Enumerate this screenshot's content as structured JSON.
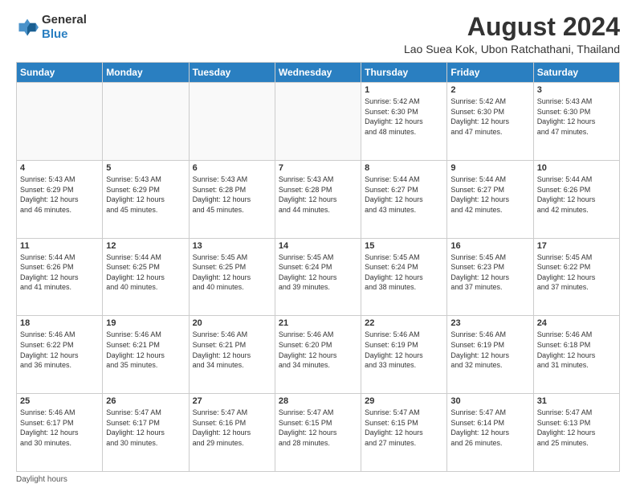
{
  "logo": {
    "general": "General",
    "blue": "Blue"
  },
  "header": {
    "month_year": "August 2024",
    "location": "Lao Suea Kok, Ubon Ratchathani, Thailand"
  },
  "days_of_week": [
    "Sunday",
    "Monday",
    "Tuesday",
    "Wednesday",
    "Thursday",
    "Friday",
    "Saturday"
  ],
  "footer": {
    "note": "Daylight hours"
  },
  "weeks": [
    [
      {
        "day": "",
        "info": ""
      },
      {
        "day": "",
        "info": ""
      },
      {
        "day": "",
        "info": ""
      },
      {
        "day": "",
        "info": ""
      },
      {
        "day": "1",
        "info": "Sunrise: 5:42 AM\nSunset: 6:30 PM\nDaylight: 12 hours\nand 48 minutes."
      },
      {
        "day": "2",
        "info": "Sunrise: 5:42 AM\nSunset: 6:30 PM\nDaylight: 12 hours\nand 47 minutes."
      },
      {
        "day": "3",
        "info": "Sunrise: 5:43 AM\nSunset: 6:30 PM\nDaylight: 12 hours\nand 47 minutes."
      }
    ],
    [
      {
        "day": "4",
        "info": "Sunrise: 5:43 AM\nSunset: 6:29 PM\nDaylight: 12 hours\nand 46 minutes."
      },
      {
        "day": "5",
        "info": "Sunrise: 5:43 AM\nSunset: 6:29 PM\nDaylight: 12 hours\nand 45 minutes."
      },
      {
        "day": "6",
        "info": "Sunrise: 5:43 AM\nSunset: 6:28 PM\nDaylight: 12 hours\nand 45 minutes."
      },
      {
        "day": "7",
        "info": "Sunrise: 5:43 AM\nSunset: 6:28 PM\nDaylight: 12 hours\nand 44 minutes."
      },
      {
        "day": "8",
        "info": "Sunrise: 5:44 AM\nSunset: 6:27 PM\nDaylight: 12 hours\nand 43 minutes."
      },
      {
        "day": "9",
        "info": "Sunrise: 5:44 AM\nSunset: 6:27 PM\nDaylight: 12 hours\nand 42 minutes."
      },
      {
        "day": "10",
        "info": "Sunrise: 5:44 AM\nSunset: 6:26 PM\nDaylight: 12 hours\nand 42 minutes."
      }
    ],
    [
      {
        "day": "11",
        "info": "Sunrise: 5:44 AM\nSunset: 6:26 PM\nDaylight: 12 hours\nand 41 minutes."
      },
      {
        "day": "12",
        "info": "Sunrise: 5:44 AM\nSunset: 6:25 PM\nDaylight: 12 hours\nand 40 minutes."
      },
      {
        "day": "13",
        "info": "Sunrise: 5:45 AM\nSunset: 6:25 PM\nDaylight: 12 hours\nand 40 minutes."
      },
      {
        "day": "14",
        "info": "Sunrise: 5:45 AM\nSunset: 6:24 PM\nDaylight: 12 hours\nand 39 minutes."
      },
      {
        "day": "15",
        "info": "Sunrise: 5:45 AM\nSunset: 6:24 PM\nDaylight: 12 hours\nand 38 minutes."
      },
      {
        "day": "16",
        "info": "Sunrise: 5:45 AM\nSunset: 6:23 PM\nDaylight: 12 hours\nand 37 minutes."
      },
      {
        "day": "17",
        "info": "Sunrise: 5:45 AM\nSunset: 6:22 PM\nDaylight: 12 hours\nand 37 minutes."
      }
    ],
    [
      {
        "day": "18",
        "info": "Sunrise: 5:46 AM\nSunset: 6:22 PM\nDaylight: 12 hours\nand 36 minutes."
      },
      {
        "day": "19",
        "info": "Sunrise: 5:46 AM\nSunset: 6:21 PM\nDaylight: 12 hours\nand 35 minutes."
      },
      {
        "day": "20",
        "info": "Sunrise: 5:46 AM\nSunset: 6:21 PM\nDaylight: 12 hours\nand 34 minutes."
      },
      {
        "day": "21",
        "info": "Sunrise: 5:46 AM\nSunset: 6:20 PM\nDaylight: 12 hours\nand 34 minutes."
      },
      {
        "day": "22",
        "info": "Sunrise: 5:46 AM\nSunset: 6:19 PM\nDaylight: 12 hours\nand 33 minutes."
      },
      {
        "day": "23",
        "info": "Sunrise: 5:46 AM\nSunset: 6:19 PM\nDaylight: 12 hours\nand 32 minutes."
      },
      {
        "day": "24",
        "info": "Sunrise: 5:46 AM\nSunset: 6:18 PM\nDaylight: 12 hours\nand 31 minutes."
      }
    ],
    [
      {
        "day": "25",
        "info": "Sunrise: 5:46 AM\nSunset: 6:17 PM\nDaylight: 12 hours\nand 30 minutes."
      },
      {
        "day": "26",
        "info": "Sunrise: 5:47 AM\nSunset: 6:17 PM\nDaylight: 12 hours\nand 30 minutes."
      },
      {
        "day": "27",
        "info": "Sunrise: 5:47 AM\nSunset: 6:16 PM\nDaylight: 12 hours\nand 29 minutes."
      },
      {
        "day": "28",
        "info": "Sunrise: 5:47 AM\nSunset: 6:15 PM\nDaylight: 12 hours\nand 28 minutes."
      },
      {
        "day": "29",
        "info": "Sunrise: 5:47 AM\nSunset: 6:15 PM\nDaylight: 12 hours\nand 27 minutes."
      },
      {
        "day": "30",
        "info": "Sunrise: 5:47 AM\nSunset: 6:14 PM\nDaylight: 12 hours\nand 26 minutes."
      },
      {
        "day": "31",
        "info": "Sunrise: 5:47 AM\nSunset: 6:13 PM\nDaylight: 12 hours\nand 25 minutes."
      }
    ]
  ]
}
